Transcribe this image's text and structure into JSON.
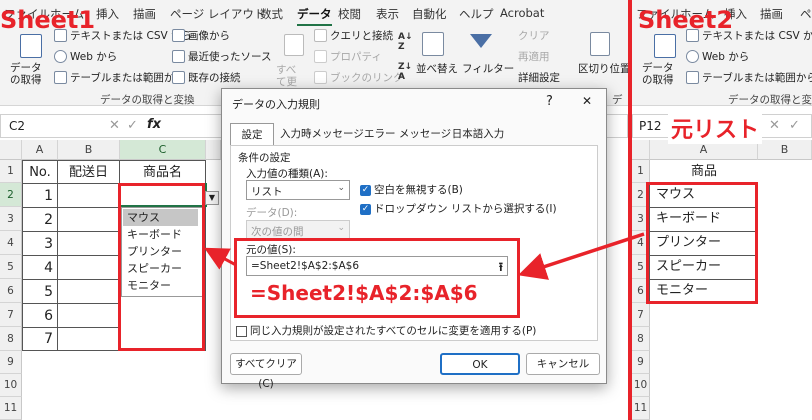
{
  "left_tabs": [
    "ファイル",
    "ホーム",
    "挿入",
    "描画",
    "ページ レイアウト",
    "数式",
    "データ",
    "校閲",
    "表示",
    "自動化",
    "ヘルプ",
    "Acrobat"
  ],
  "right_tabs": [
    "ファイル",
    "ホーム",
    "挿入",
    "描画",
    "ペ"
  ],
  "ribbon_left": {
    "get_data": "データの取得",
    "from_text": "テキストまたは CSV から",
    "from_web": "Web から",
    "from_table": "テーブルまたは範囲から",
    "from_image": "画像から",
    "recent_sources": "最近使ったソース",
    "existing_conn": "既存の接続",
    "refresh_all": "すべて更新",
    "queries": "クエリと接続",
    "properties": "プロパティ",
    "book_links": "ブックのリンク",
    "sort": "並べ替え",
    "filter": "フィルター",
    "clear": "クリア",
    "reapply": "再適用",
    "advanced": "詳細設定",
    "text_to_cols": "区切り位置",
    "group_get": "データの取得と変換",
    "group_data": "デ"
  },
  "ribbon_right": {
    "get_data": "データの取得",
    "from_text": "テキストまたは CSV から",
    "from_web": "Web から",
    "from_table": "テーブルまたは範囲から",
    "group_get": "データの取得と変換"
  },
  "left_namebox": "C2",
  "right_namebox": "P12",
  "left_cols": [
    "A",
    "B",
    "C"
  ],
  "left_headers": {
    "no": "No.",
    "date": "配送日",
    "product": "商品名"
  },
  "left_row_numbers": [
    "1",
    "2",
    "3",
    "4",
    "5",
    "6",
    "7",
    "8",
    "9",
    "10",
    "11"
  ],
  "left_nos": [
    "1",
    "2",
    "3",
    "4",
    "5",
    "6",
    "7"
  ],
  "dropdown_items": [
    "マウス",
    "キーボード",
    "プリンター",
    "スピーカー",
    "モニター"
  ],
  "right_cols": [
    "A",
    "B"
  ],
  "right_header": "商品",
  "right_items": [
    "マウス",
    "キーボード",
    "プリンター",
    "スピーカー",
    "モニター"
  ],
  "right_row_numbers": [
    "1",
    "2",
    "3",
    "4",
    "5",
    "6",
    "7",
    "8",
    "9",
    "10",
    "11"
  ],
  "dialog": {
    "title": "データの入力規則",
    "help": "?",
    "close": "✕",
    "tabs": [
      "設定",
      "入力時メッセージ",
      "エラー メッセージ",
      "日本語入力"
    ],
    "section": "条件の設定",
    "allow_label": "入力値の種類(A):",
    "allow_value": "リスト",
    "data_label": "データ(D):",
    "data_value": "次の値の間",
    "ignore_blank": "空白を無視する(B)",
    "in_cell_dropdown": "ドロップダウン リストから選択する(I)",
    "source_label": "元の値(S):",
    "source_value": "=Sheet2!$A$2:$A$6",
    "apply_all": "同じ入力規則が設定されたすべてのセルに変更を適用する(P)",
    "clear_all": "すべてクリア(C)",
    "ok": "OK",
    "cancel": "キャンセル"
  },
  "annotations": {
    "sheet1": "Sheet1",
    "sheet2": "Sheet2",
    "source_list": "元リスト",
    "formula": "=Sheet2!$A$2:$A$6"
  },
  "colors": {
    "accent_red": "#e8232a",
    "ribbon_bg": "#f3f3f3",
    "excel_green": "#217346"
  }
}
